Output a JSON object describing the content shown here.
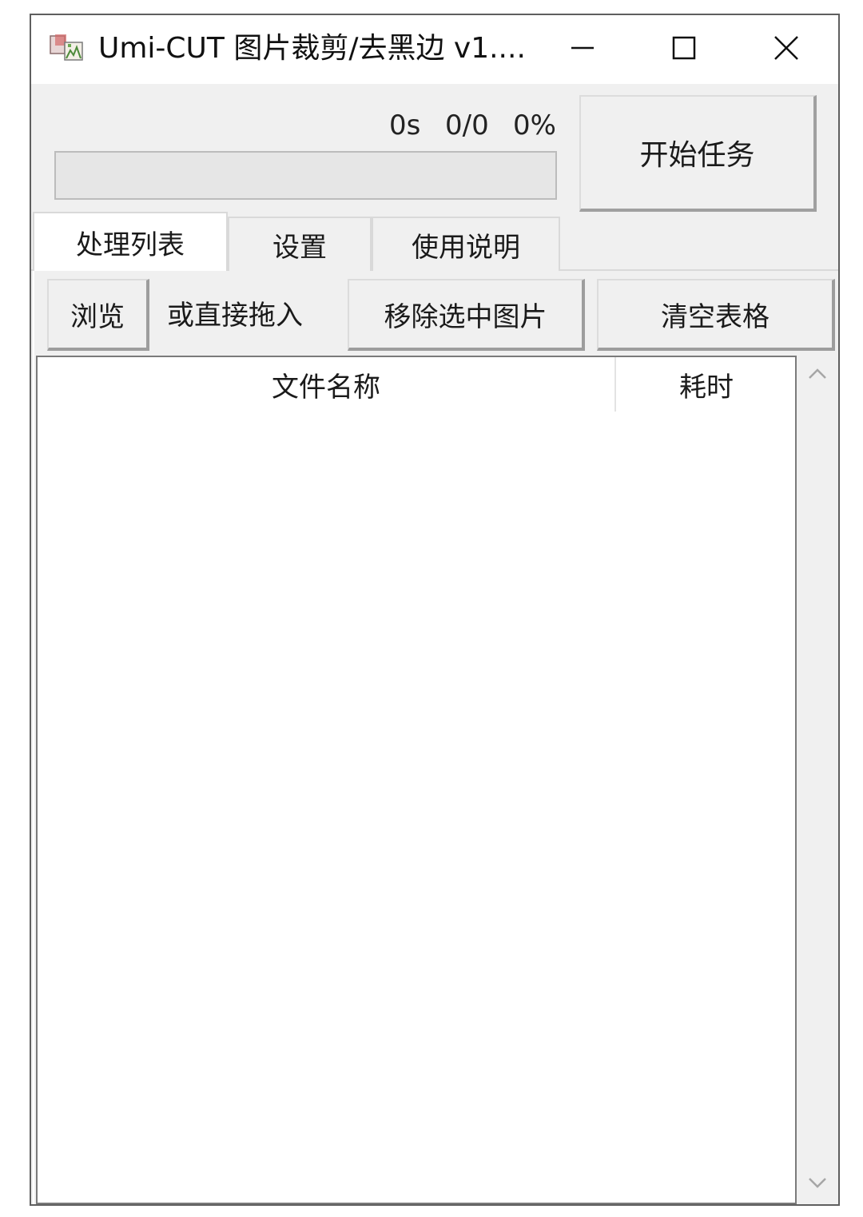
{
  "window": {
    "title": "Umi-CUT 图片裁剪/去黑边 v1....",
    "icon": "app-image-icon"
  },
  "controls": {
    "minimize_icon": "minimize-icon",
    "maximize_icon": "maximize-icon",
    "close_icon": "close-icon"
  },
  "status": {
    "elapsed": "0s",
    "count": "0/0",
    "percent": "0%",
    "progress_fraction": 0
  },
  "start_button": {
    "label": "开始任务"
  },
  "tabs": [
    {
      "label": "处理列表",
      "active": true
    },
    {
      "label": "设置",
      "active": false
    },
    {
      "label": "使用说明",
      "active": false
    }
  ],
  "toolbar": {
    "browse_label": "浏览",
    "drop_hint": "或直接拖入",
    "remove_label": "移除选中图片",
    "clear_label": "清空表格"
  },
  "table": {
    "columns": [
      "文件名称",
      "耗时"
    ],
    "rows": []
  },
  "colors": {
    "window_bg": "#f0f0f0",
    "border": "#5f5f5f",
    "progress_fill": "#06b025"
  }
}
